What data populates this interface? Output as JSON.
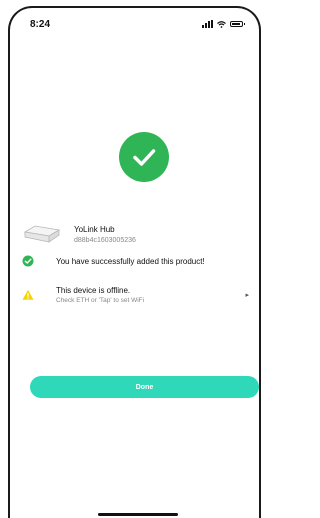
{
  "status_bar": {
    "time": "8:24"
  },
  "device": {
    "name": "YoLink Hub",
    "id": "d88b4c1603005236"
  },
  "messages": {
    "success": "You have successfully added this product!",
    "offline_title": "This device is offline.",
    "offline_hint": "Check ETH or 'Tap' to set WiFi"
  },
  "done_button": {
    "label": "Done"
  },
  "colors": {
    "success": "#2fb556",
    "warning": "#f5d400",
    "accent": "#2ed8b8"
  },
  "icons": [
    "checkmark-icon",
    "warning-icon",
    "chevron-right-icon",
    "hub-image"
  ]
}
